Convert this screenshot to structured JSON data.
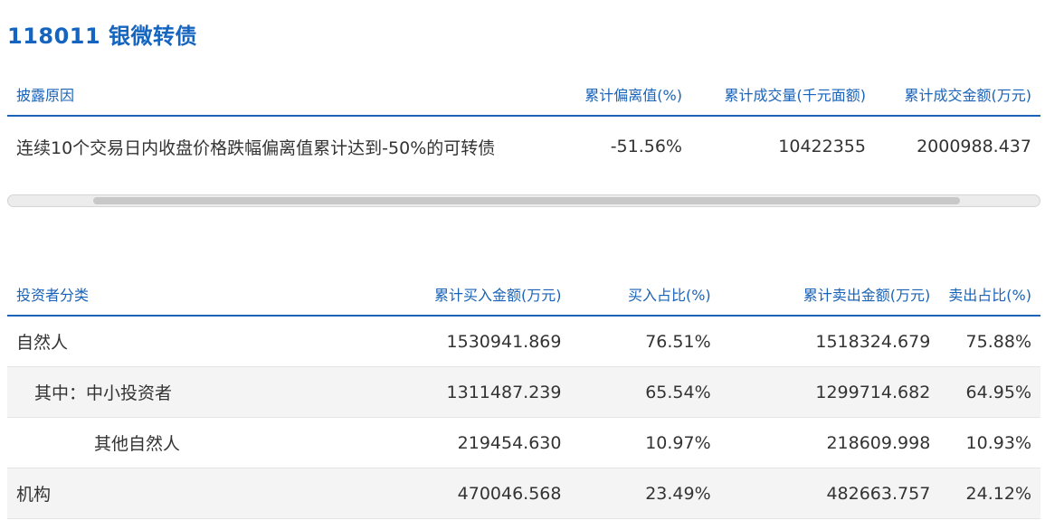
{
  "title": "118011 银微转债",
  "disclosure_table": {
    "headers": [
      "披露原因",
      "累计偏离值(%)",
      "累计成交量(千元面额)",
      "累计成交金额(万元)"
    ],
    "row": [
      "连续10个交易日内收盘价格跌幅偏离值累计达到-50%的可转债",
      "-51.56%",
      "10422355",
      "2000988.437"
    ]
  },
  "investor_table": {
    "headers": [
      "投资者分类",
      "累计买入金额(万元)",
      "买入占比(%)",
      "累计卖出金额(万元)",
      "卖出占比(%)"
    ],
    "rows": [
      [
        "自然人",
        "1530941.869",
        "76.51%",
        "1518324.679",
        "75.88%"
      ],
      [
        "其中：中小投资者",
        "1311487.239",
        "65.54%",
        "1299714.682",
        "64.95%"
      ],
      [
        "其他自然人",
        "219454.630",
        "10.97%",
        "218609.998",
        "10.93%"
      ],
      [
        "机构",
        "470046.568",
        "23.49%",
        "482663.757",
        "24.12%"
      ]
    ]
  }
}
